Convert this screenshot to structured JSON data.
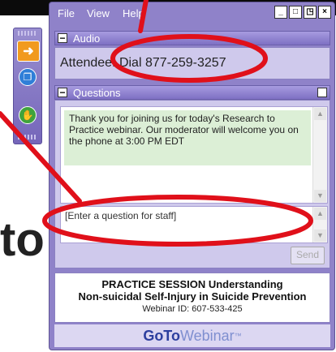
{
  "background": {
    "partial_word": "to"
  },
  "menu": {
    "file": "File",
    "view": "View",
    "help": "Help"
  },
  "window_buttons": [
    "_",
    "□",
    "◳",
    "×"
  ],
  "audio": {
    "title": "Audio",
    "info": "Attendee: Dial 877-259-3257"
  },
  "questions": {
    "title": "Questions",
    "message": "Thank you for joining us for today's Research to Practice webinar. Our moderator will welcome you on the phone at 3:00 PM EDT",
    "input_value": "[Enter a question for staff]",
    "send_label": "Send"
  },
  "session": {
    "line1": "PRACTICE SESSION Understanding",
    "line2": "Non-suicidal Self-Injury in Suicide Prevention",
    "webinar_id": "Webinar ID: 607-533-425"
  },
  "brand": {
    "goto": "GoTo",
    "webinar": "Webinar",
    "tm": "™"
  },
  "colors": {
    "panel": "#8f82c9",
    "annotation": "#e0101a",
    "message_bg": "#dcefd6"
  },
  "icons": [
    "arrow-right-icon",
    "window-icon",
    "raise-hand-icon",
    "collapse-icon",
    "popout-icon"
  ]
}
